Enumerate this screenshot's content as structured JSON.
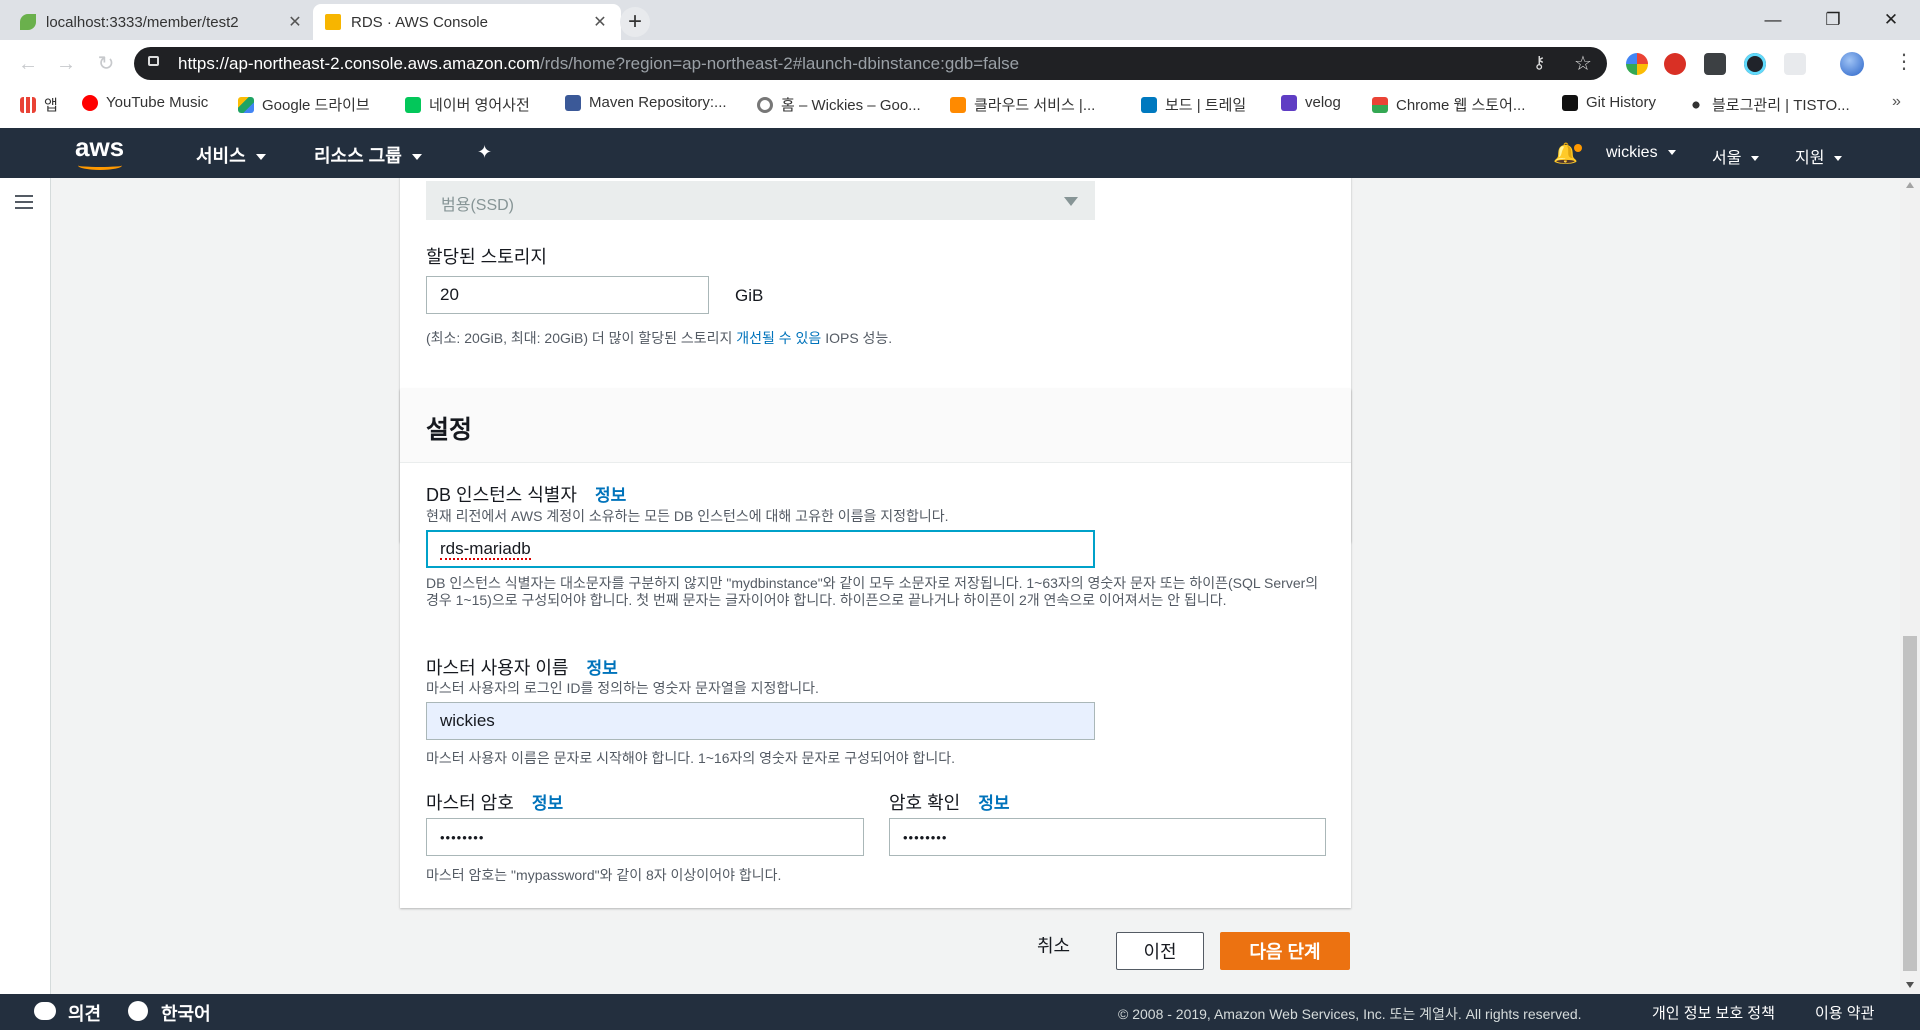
{
  "browser": {
    "tabs": [
      {
        "title": "localhost:3333/member/test2",
        "close": "✕"
      },
      {
        "title": "RDS · AWS Console",
        "close": "✕"
      }
    ],
    "new_tab": "+",
    "window_controls": {
      "minimize": "—",
      "maximize": "❐",
      "close": "✕"
    },
    "back": "←",
    "forward": "→",
    "reload": "↻",
    "url_host": "https://ap-northeast-2.console.aws.amazon.com",
    "url_path": "/rds/home?region=ap-northeast-2#launch-dbinstance:gdb=false",
    "key_icon": "⚷",
    "star_icon": "☆",
    "menu_icon": "⋮",
    "bookmarks": [
      {
        "label": "앱",
        "color": "#e94235"
      },
      {
        "label": "YouTube Music",
        "color": "#ff0000"
      },
      {
        "label": "Google 드라이브",
        "color": "#1fa463"
      },
      {
        "label": "네이버 영어사전",
        "color": "#03c75a"
      },
      {
        "label": "Maven Repository:...",
        "color": "#3b5998"
      },
      {
        "label": "홈 – Wickies – Goo...",
        "color": "#777777"
      },
      {
        "label": "클라우드 서비스 |...",
        "color": "#ff8a00"
      },
      {
        "label": "보드 | 트레일",
        "color": "#0079bf"
      },
      {
        "label": "velog",
        "color": "#5f3dc4"
      },
      {
        "label": "Chrome 웹 스토어...",
        "color": "#fbbc05"
      },
      {
        "label": "Git History",
        "color": "#111111"
      },
      {
        "label": "블로그관리 | TISTO...",
        "color": "#333333"
      }
    ],
    "bookmarks_more": "»"
  },
  "aws_nav": {
    "logo": "aws",
    "services": "서비스",
    "resource_groups": "리소스 그룹",
    "pin": "✦",
    "bell": "🔔",
    "account": "wickies",
    "region": "서울",
    "support": "지원"
  },
  "storage": {
    "storage_type": "범용(SSD)",
    "allocated_label": "할당된 스토리지",
    "allocated_value": "20",
    "unit": "GiB",
    "hint_prefix": "(최소: 20GiB, 최대: 20GiB) 더 많이 할당된 스토리지 ",
    "hint_link": "개선될 수 있음",
    "hint_suffix": " IOPS 성능."
  },
  "settings": {
    "title": "설정",
    "info": "정보",
    "db_id_label": "DB 인스턴스 식별자",
    "db_id_desc": "현재 리전에서 AWS 계정이 소유하는 모든 DB 인스턴스에 대해 고유한 이름을 지정합니다.",
    "db_id_value": "rds-mariadb",
    "db_id_rule": "DB 인스턴스 식별자는 대소문자를 구분하지 않지만 \"mydbinstance\"와 같이 모두 소문자로 저장됩니다. 1~63자의 영숫자 문자 또는 하이픈(SQL Server의 경우 1~15)으로 구성되어야 합니다. 첫 번째 문자는 글자이어야 합니다. 하이픈으로 끝나거나 하이픈이 2개 연속으로 이어져서는 안 됩니다.",
    "master_user_label": "마스터 사용자 이름",
    "master_user_desc": "마스터 사용자의 로그인 ID를 정의하는 영숫자 문자열을 지정합니다.",
    "master_user_value": "wickies",
    "master_user_rule": "마스터 사용자 이름은 문자로 시작해야 합니다. 1~16자의 영숫자 문자로 구성되어야 합니다.",
    "master_pw_label": "마스터 암호",
    "master_pw_value": "••••••••",
    "confirm_pw_label": "암호 확인",
    "confirm_pw_value": "••••••••",
    "pw_rule": "마스터 암호는 \"mypassword\"와 같이 8자 이상이어야 합니다."
  },
  "actions": {
    "cancel": "취소",
    "previous": "이전",
    "next": "다음 단계"
  },
  "footer": {
    "feedback": "의견",
    "language": "한국어",
    "copyright": "© 2008 - 2019, Amazon Web Services, Inc. 또는 계열사. All rights reserved.",
    "privacy": "개인 정보 보호 정책",
    "terms": "이용 약관"
  },
  "colors": {
    "aws_nav": "#232f3e",
    "accent_orange": "#ec7211",
    "link_blue": "#0073bb",
    "focus_border": "#00a1c9"
  }
}
